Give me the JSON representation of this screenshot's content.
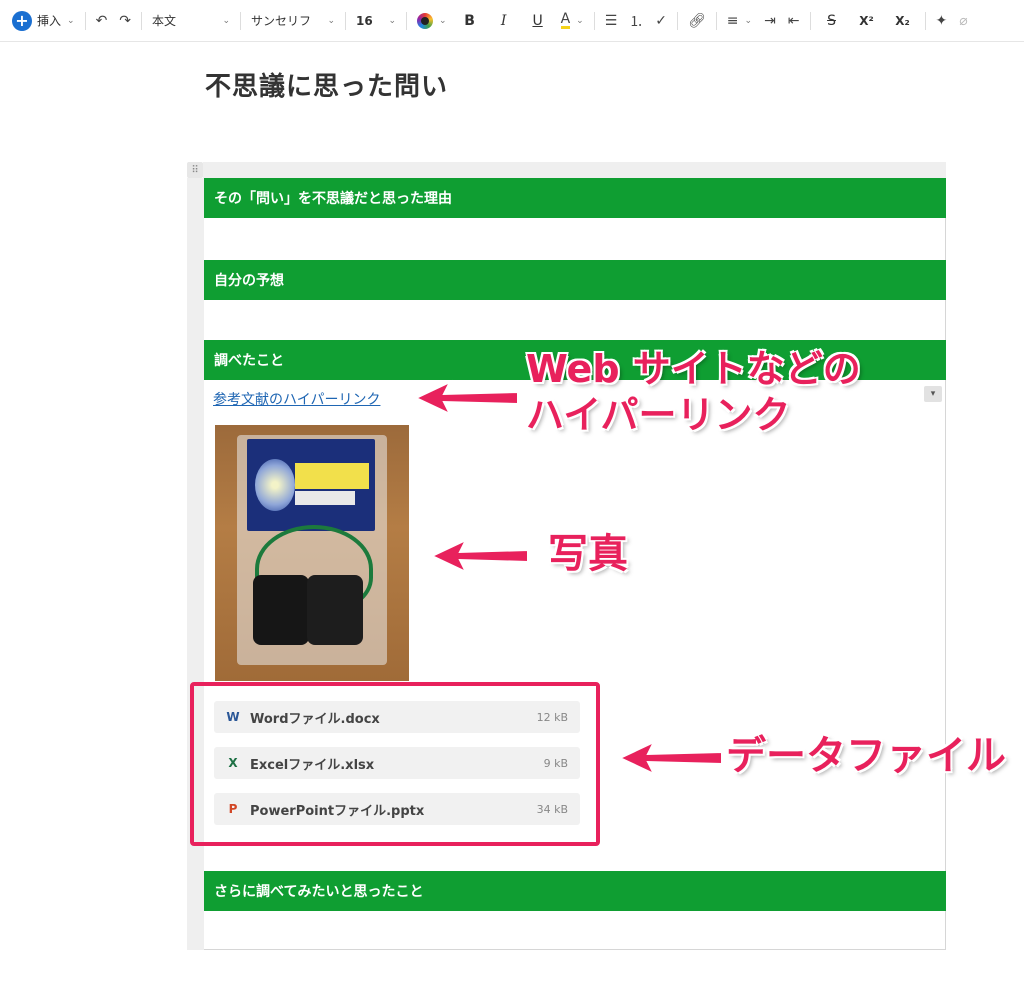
{
  "toolbar": {
    "insert_label": "挿入",
    "paragraph_style": "本文",
    "font_family": "サンセリフ",
    "font_size": "16",
    "bold": "B",
    "italic": "I",
    "underline": "U",
    "highlight": "A",
    "superscript": "X²",
    "subscript": "X₂"
  },
  "page": {
    "title": "不思議に思った問い"
  },
  "sections": [
    {
      "header": "その「問い」を不思議だと思った理由"
    },
    {
      "header": "自分の予想"
    },
    {
      "header": "調べたこと"
    },
    {
      "header": "さらに調べてみたいと思ったこと"
    }
  ],
  "content": {
    "link_text": "参考文献のハイパーリンク",
    "files": [
      {
        "icon_letter": "W",
        "icon_color": "#2b5797",
        "name": "Wordファイル.docx",
        "size": "12 kB"
      },
      {
        "icon_letter": "X",
        "icon_color": "#1d7044",
        "name": "Excelファイル.xlsx",
        "size": "9 kB"
      },
      {
        "icon_letter": "P",
        "icon_color": "#d24726",
        "name": "PowerPointファイル.pptx",
        "size": "34 kB"
      }
    ]
  },
  "annotations": {
    "link_note_line1": "Web サイトなどの",
    "link_note_line2": "ハイパーリンク",
    "photo_note": "写真",
    "files_note": "データファイル",
    "accent_color": "#e8215c"
  },
  "colors": {
    "section_header": "#0f9e32",
    "link": "#1f66b3"
  }
}
